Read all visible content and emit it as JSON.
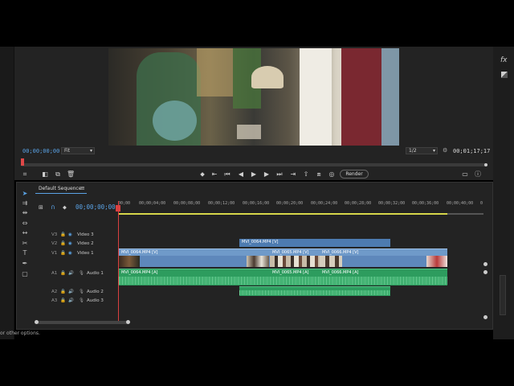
{
  "monitor": {
    "current_timecode": "00;00;00;00",
    "fit_option": "Fit",
    "resolution_option": "1/2",
    "duration_timecode": "00;01;17;17",
    "fx_label": "fx",
    "render_label": "Render"
  },
  "timeline": {
    "sequence_name": "Default Sequence",
    "menu_glyph": "≡",
    "timecode": "00;00;00;00",
    "ruler_ticks": [
      "00;00",
      "00;00;04;00",
      "00;00;08;00",
      "00;00;12;00",
      "00;00;16;00",
      "00;00;20;00",
      "00;00;24;00",
      "00;00;28;00",
      "00;00;32;00",
      "00;00;36;00",
      "00;00;40;00",
      "0"
    ],
    "video_tracks": [
      {
        "id": "V3",
        "name": "Video 3"
      },
      {
        "id": "V2",
        "name": "Video 2"
      },
      {
        "id": "V1",
        "name": "Video 1"
      }
    ],
    "audio_tracks": [
      {
        "id": "A1",
        "name": "Audio 1"
      },
      {
        "id": "A2",
        "name": "Audio 2"
      },
      {
        "id": "A3",
        "name": "Audio 3"
      }
    ],
    "clips": {
      "v2_clip": "MVI_0064.MP4 [V]",
      "v1_clip1": "MVI_0064.MP4 [V]",
      "v1_clip2": "MVI_0065.MP4 [V]",
      "v1_clip3": "MVI_0066.MP4 [V]",
      "a1_clip1": "MVI_0064.MP4 [A]",
      "a1_clip2": "MVI_0065.MP4 [A]",
      "a1_clip3": "MVI_0066.MP4 [A]"
    }
  },
  "status_bar": {
    "text": "or other options."
  },
  "colors": {
    "accent_blue": "#5aa3e6",
    "playhead_red": "#d94040",
    "video_clip": "#6f9ac9",
    "audio_clip": "#2d9c5e"
  }
}
